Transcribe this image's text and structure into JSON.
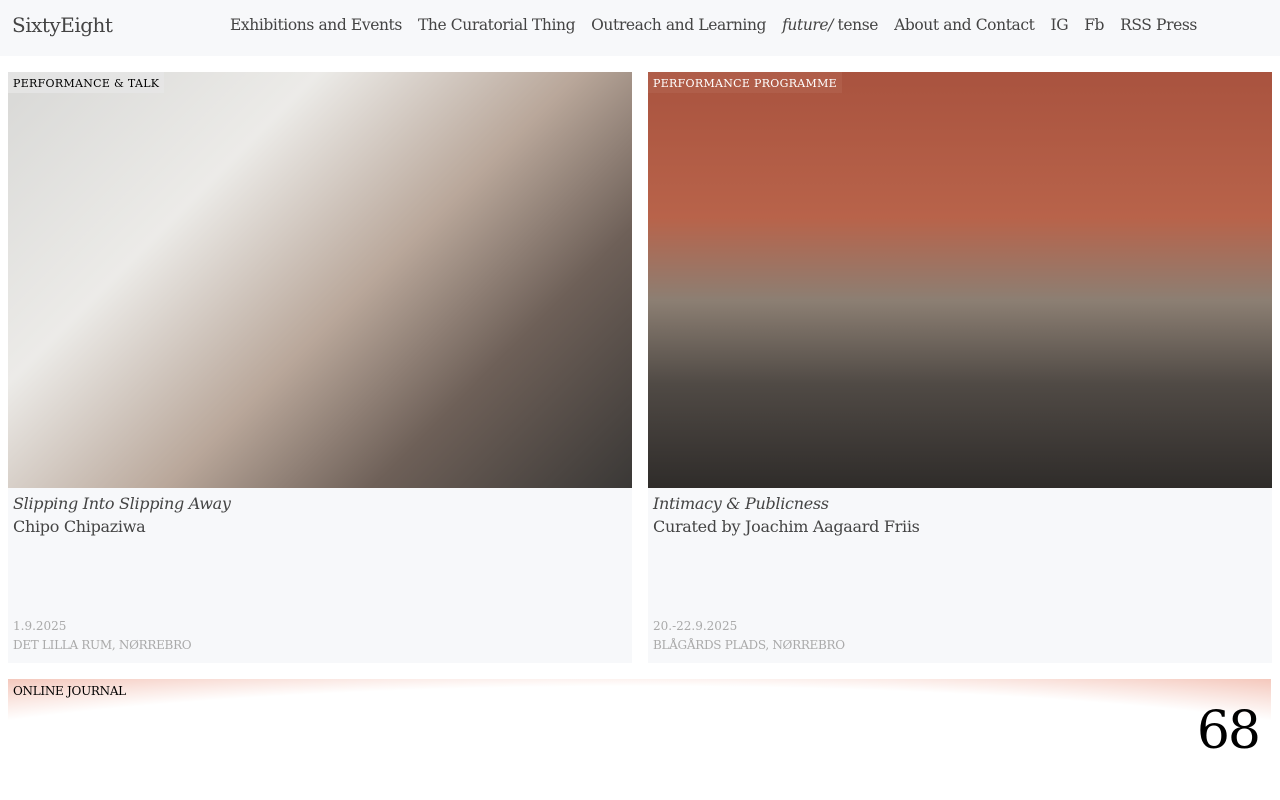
{
  "header": {
    "logo": "SixtyEight",
    "nav": [
      "Exhibitions and Events",
      "The Curatorial Thing",
      "Outreach and Learning",
      "future/",
      "tense",
      "About and Contact",
      "IG",
      "Fb",
      "RSS Press"
    ]
  },
  "cards": [
    {
      "tag": "PERFORMANCE & TALK",
      "title": "Slipping Into Slipping Away",
      "subtitle": "Chipo Chipaziwa",
      "date": "1.9.2025",
      "place": "DET LILLA RUM, NØRREBRO"
    },
    {
      "tag": "PERFORMANCE PROGRAMME",
      "title": "Intimacy & Publicness",
      "subtitle": "Curated by Joachim Aagaard Friis",
      "date": "20.-22.9.2025",
      "place": "BLÅGÅRDS PLADS, NØRREBRO"
    }
  ],
  "journal": {
    "tag": "ONLINE JOURNAL",
    "number": "68"
  }
}
